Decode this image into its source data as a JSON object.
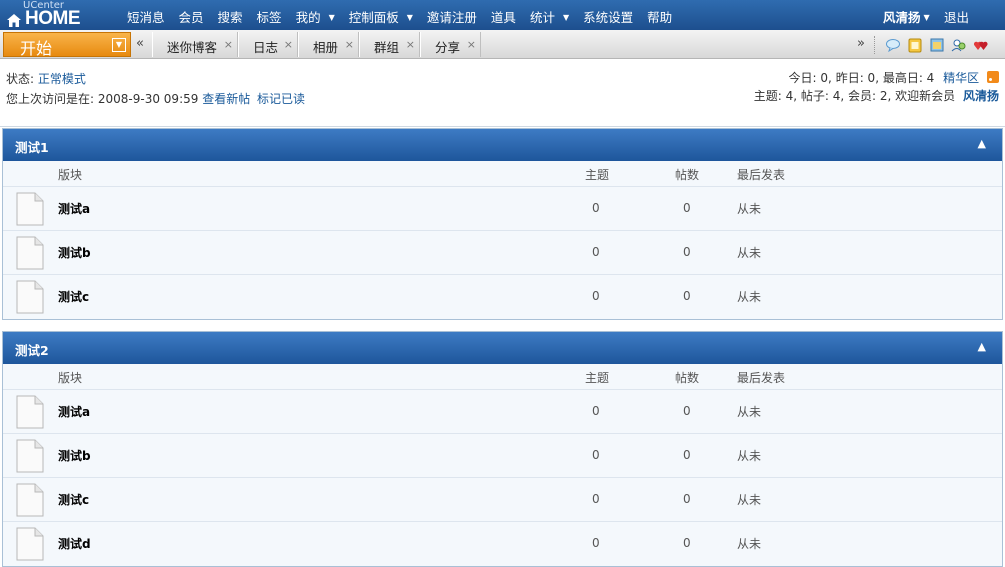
{
  "logo": {
    "small": "UCenter",
    "big": "HOME"
  },
  "nav": [
    {
      "label": "短消息",
      "dropdown": false
    },
    {
      "label": "会员",
      "dropdown": false
    },
    {
      "label": "搜索",
      "dropdown": false
    },
    {
      "label": "标签",
      "dropdown": false
    },
    {
      "label": "我的",
      "dropdown": true
    },
    {
      "label": "控制面板",
      "dropdown": true
    },
    {
      "label": "邀请注册",
      "dropdown": false
    },
    {
      "label": "道具",
      "dropdown": false
    },
    {
      "label": "统计",
      "dropdown": true
    },
    {
      "label": "系统设置",
      "dropdown": false
    },
    {
      "label": "帮助",
      "dropdown": false
    }
  ],
  "user": {
    "name": "风清扬",
    "logout": "退出"
  },
  "tabbar": {
    "start": "开始",
    "prev": "«",
    "next": "»",
    "tabs": [
      "迷你博客",
      "日志",
      "相册",
      "群组",
      "分享"
    ],
    "icons": [
      "chat-bubble-icon",
      "notepad-icon",
      "calendar-icon",
      "users-icon",
      "hearts-icon"
    ]
  },
  "status": {
    "mode_label": "状态:",
    "mode_value": "正常模式",
    "last_visit_label": "您上次访问是在:",
    "last_visit_time": "2008-9-30 09:59",
    "view_new": "查看新帖",
    "mark_read": "标记已读",
    "today": "今日: 0",
    "yesterday": "昨日: 0",
    "max": "最高日: 4",
    "digest": "精华区",
    "stats": "主题: 4, 帖子: 4, 会员: 2, 欢迎新会员",
    "new_member": "风清扬"
  },
  "columns": {
    "forum": "版块",
    "topics": "主题",
    "posts": "帖数",
    "last": "最后发表"
  },
  "groups": [
    {
      "title": "测试1",
      "forums": [
        {
          "name": "测试a",
          "topics": "0",
          "posts": "0",
          "last": "从未"
        },
        {
          "name": "测试b",
          "topics": "0",
          "posts": "0",
          "last": "从未"
        },
        {
          "name": "测试c",
          "topics": "0",
          "posts": "0",
          "last": "从未"
        }
      ]
    },
    {
      "title": "测试2",
      "forums": [
        {
          "name": "测试a",
          "topics": "0",
          "posts": "0",
          "last": "从未"
        },
        {
          "name": "测试b",
          "topics": "0",
          "posts": "0",
          "last": "从未"
        },
        {
          "name": "测试c",
          "topics": "0",
          "posts": "0",
          "last": "从未"
        },
        {
          "name": "测试d",
          "topics": "0",
          "posts": "0",
          "last": "从未"
        }
      ]
    }
  ]
}
